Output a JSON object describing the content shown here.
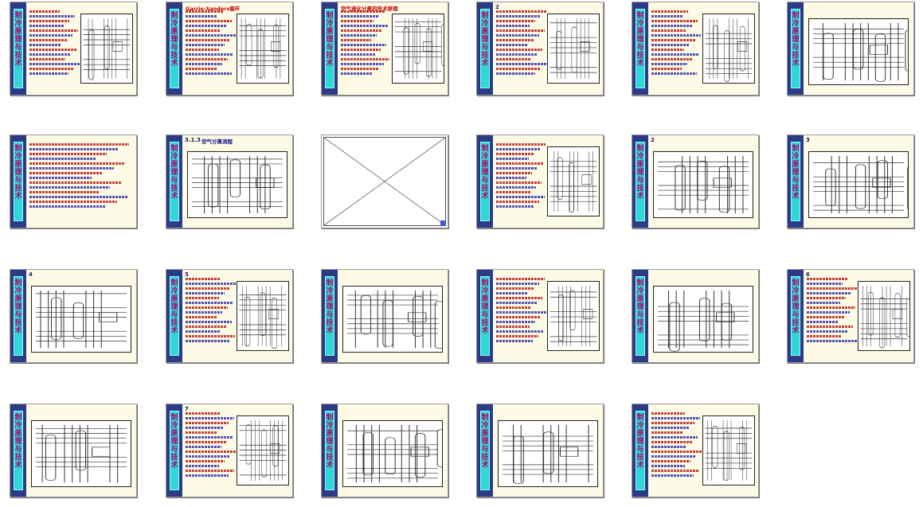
{
  "view": "slide-sorter",
  "colors": {
    "sidebar": "#2d3a86",
    "sidebar_strip": "#33d6d6",
    "sidebar_text": "#b0006a",
    "slide_bg": "#fdfbe6",
    "selection": "#1c3ccc"
  },
  "sidebar_text": "制冷原理与技术",
  "slides": [
    {
      "number": "",
      "title": "",
      "kind": "figure",
      "title_color": "blue"
    },
    {
      "number": "",
      "title": "Garrie-Sanders循环",
      "kind": "figure",
      "title_color": "red"
    },
    {
      "number": "",
      "title": "空气液化分离的技术原理",
      "kind": "figure",
      "title_color": "red"
    },
    {
      "number": "2",
      "title": "",
      "kind": "figure",
      "title_color": "blue"
    },
    {
      "number": "",
      "title": "",
      "kind": "figure",
      "title_color": "blue"
    },
    {
      "number": "",
      "title": "",
      "kind": "wide",
      "title_color": "red"
    },
    {
      "number": "",
      "title": "",
      "kind": "text",
      "title_color": "blue"
    },
    {
      "number": "3.1.3",
      "title": "空气分离流程",
      "kind": "wide",
      "title_color": "blue"
    },
    {
      "number": "",
      "title": "",
      "kind": "blank",
      "title_color": "blue"
    },
    {
      "number": "",
      "title": "",
      "kind": "figure",
      "title_color": "blue"
    },
    {
      "number": "2",
      "title": "",
      "kind": "wide",
      "title_color": "blue"
    },
    {
      "number": "3",
      "title": "",
      "kind": "wide",
      "title_color": "blue"
    },
    {
      "number": "4",
      "title": "",
      "kind": "wide",
      "title_color": "blue"
    },
    {
      "number": "5",
      "title": "",
      "kind": "figure",
      "title_color": "blue"
    },
    {
      "number": "",
      "title": "",
      "kind": "wide",
      "title_color": "red"
    },
    {
      "number": "",
      "title": "",
      "kind": "figure",
      "title_color": "red"
    },
    {
      "number": "",
      "title": "",
      "kind": "wide",
      "title_color": "blue"
    },
    {
      "number": "6",
      "title": "",
      "kind": "figure",
      "title_color": "blue"
    },
    {
      "number": "",
      "title": "",
      "kind": "wide",
      "title_color": "blue"
    },
    {
      "number": "7",
      "title": "",
      "kind": "figure",
      "title_color": "blue"
    },
    {
      "number": "",
      "title": "",
      "kind": "wide",
      "title_color": "blue"
    },
    {
      "number": "",
      "title": "",
      "kind": "wide",
      "title_color": "blue"
    },
    {
      "number": "",
      "title": "",
      "kind": "figure",
      "title_color": "red"
    }
  ]
}
